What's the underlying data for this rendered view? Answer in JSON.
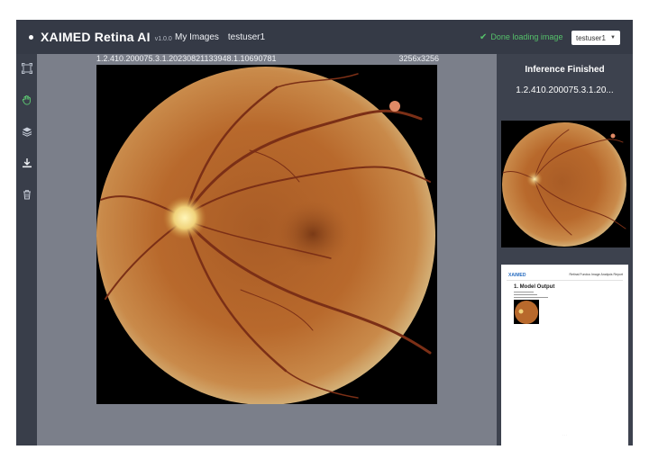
{
  "header": {
    "app_title": "XAIMED Retina AI",
    "version": "v1.0.0",
    "nav": [
      "My Images",
      "testuser1"
    ],
    "status_text": "Done loading image",
    "user_dropdown": "testuser1"
  },
  "toolbar": {
    "tools": [
      "fit-to-screen-icon",
      "pan-hand-icon",
      "layers-icon",
      "download-icon",
      "trash-icon"
    ]
  },
  "viewer": {
    "image_id": "1.2.410.200075.3.1.20230821133948.1.10690781",
    "image_dims": "3256x3256"
  },
  "right_panel": {
    "title": "Inference Finished",
    "image_id_short": "1.2.410.200075.3.1.20...",
    "report": {
      "logo": "XAIMED",
      "header": "Retinal Fundus Image Analysis Report",
      "section_title": "1. Model Output"
    }
  },
  "colors": {
    "header_bg": "#353a46",
    "viewer_bg": "#7b7f8a",
    "status_green": "#55c06a",
    "fundus_orange": "#b86a2b"
  }
}
